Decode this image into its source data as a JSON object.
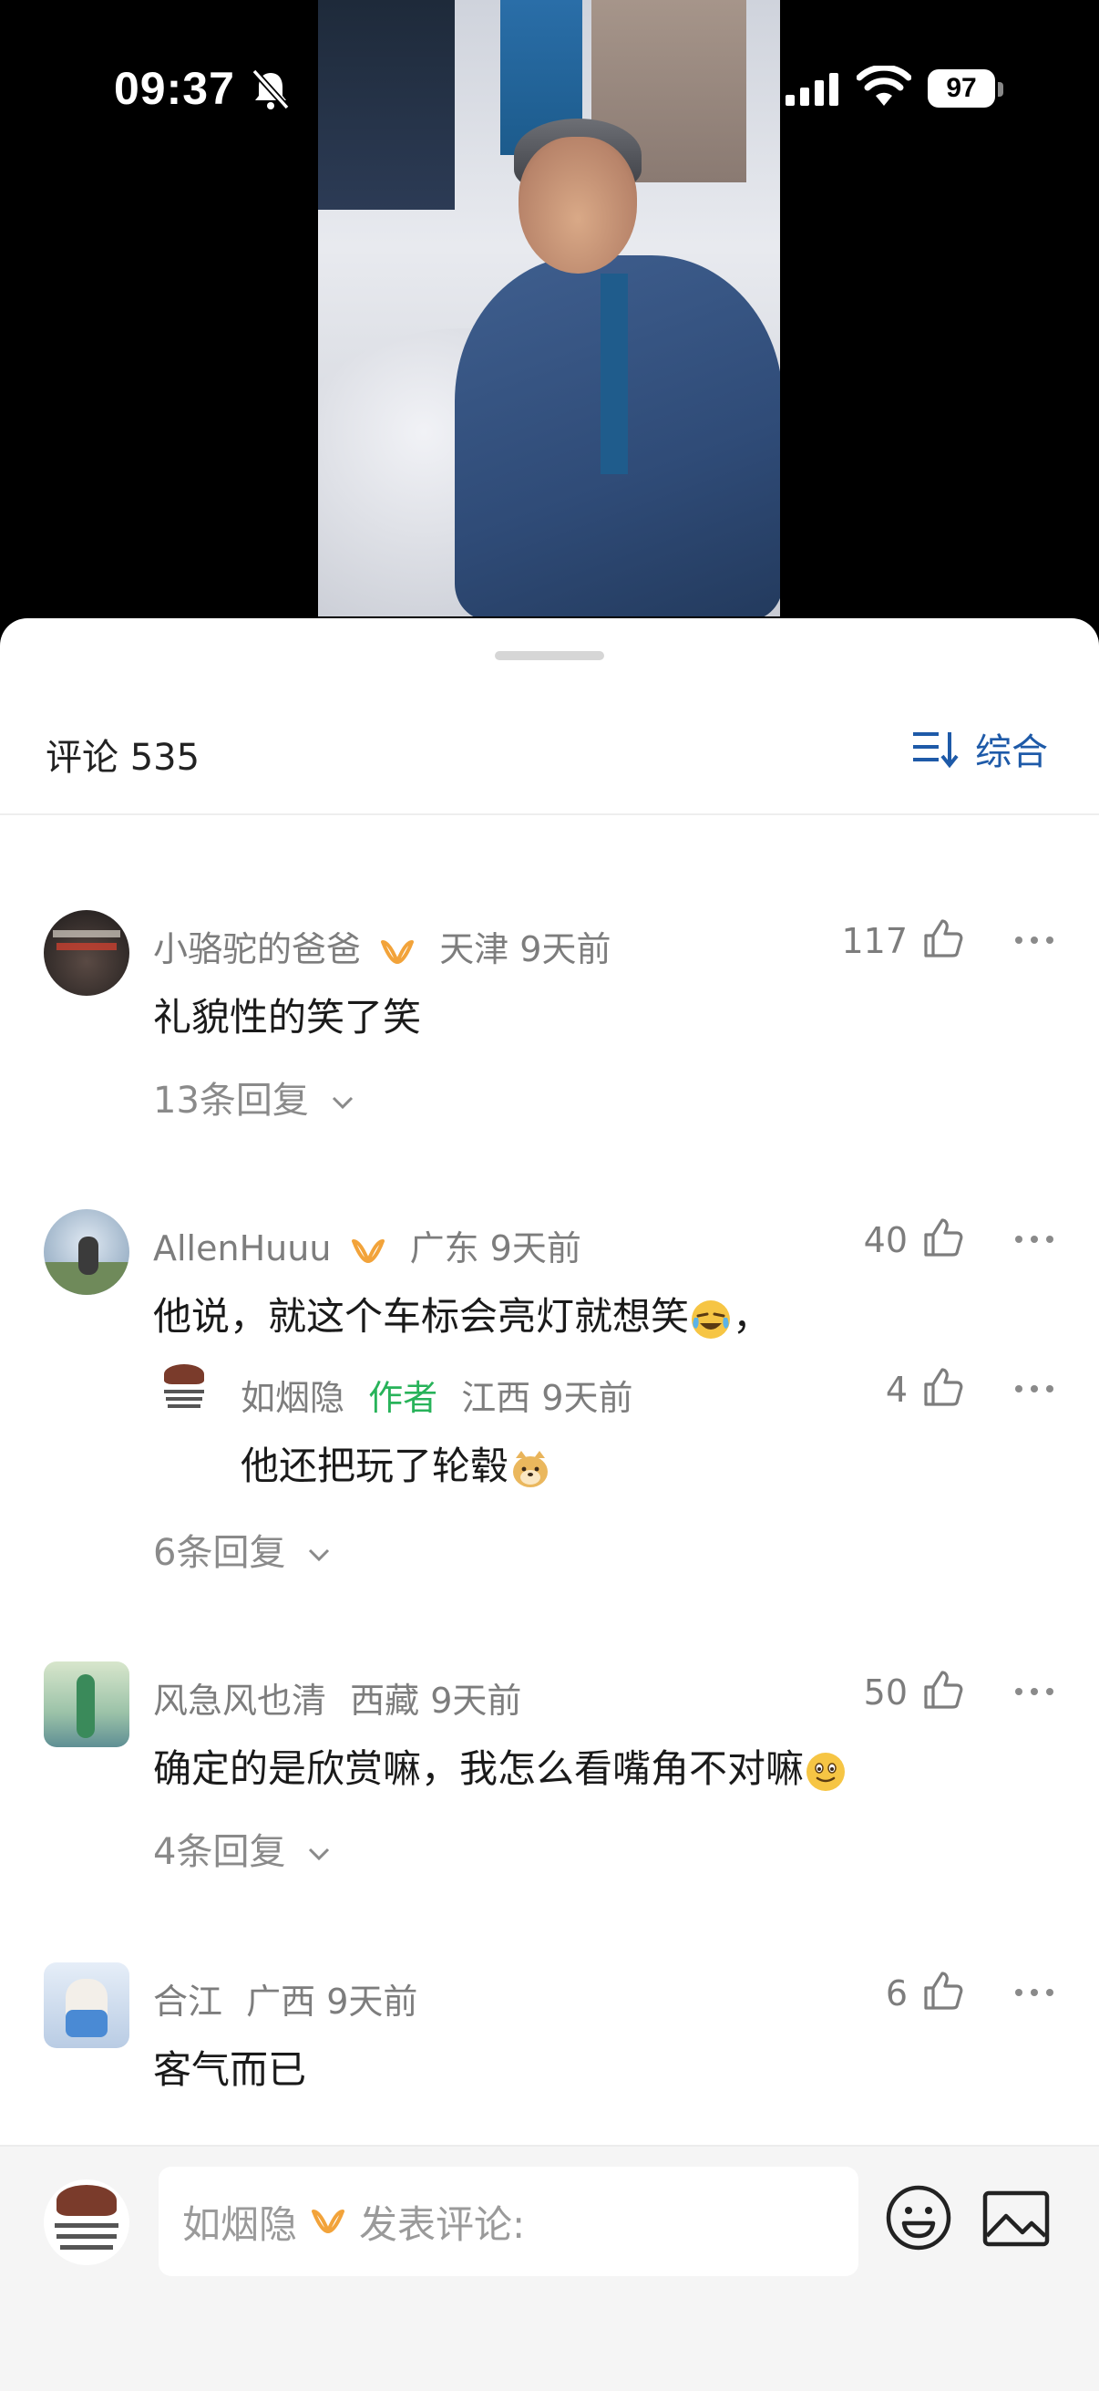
{
  "status_bar": {
    "time": "09:37",
    "battery": "97"
  },
  "comments_header": {
    "title": "评论 535",
    "sort_label": "综合"
  },
  "comments": [
    {
      "username": "小骆驼的爸爸",
      "meta": "天津 9天前",
      "text": "礼貌性的笑了笑",
      "likes": "117",
      "replies_link": "13条回复"
    },
    {
      "username": "AllenHuuu",
      "meta": "广东 9天前",
      "text": "他说，就这个车标会亮灯就想笑",
      "text_suffix": "，",
      "likes": "40",
      "reply": {
        "username": "如烟隐",
        "author_tag": "作者",
        "meta": "江西 9天前",
        "text": "他还把玩了轮毂",
        "likes": "4"
      },
      "replies_link": "6条回复"
    },
    {
      "username": "风急风也清",
      "meta": "西藏 9天前",
      "text": "确定的是欣赏嘛，我怎么看嘴角不对嘛",
      "likes": "50",
      "replies_link": "4条回复"
    },
    {
      "username": "合江",
      "meta": "广西 9天前",
      "text": "客气而已",
      "likes": "6"
    }
  ],
  "input_bar": {
    "username": "如烟隐",
    "placeholder": "发表评论:"
  },
  "colors": {
    "accent_blue": "#1e5aa8",
    "badge_orange": "#f2a33a",
    "author_green": "#28b35a"
  }
}
